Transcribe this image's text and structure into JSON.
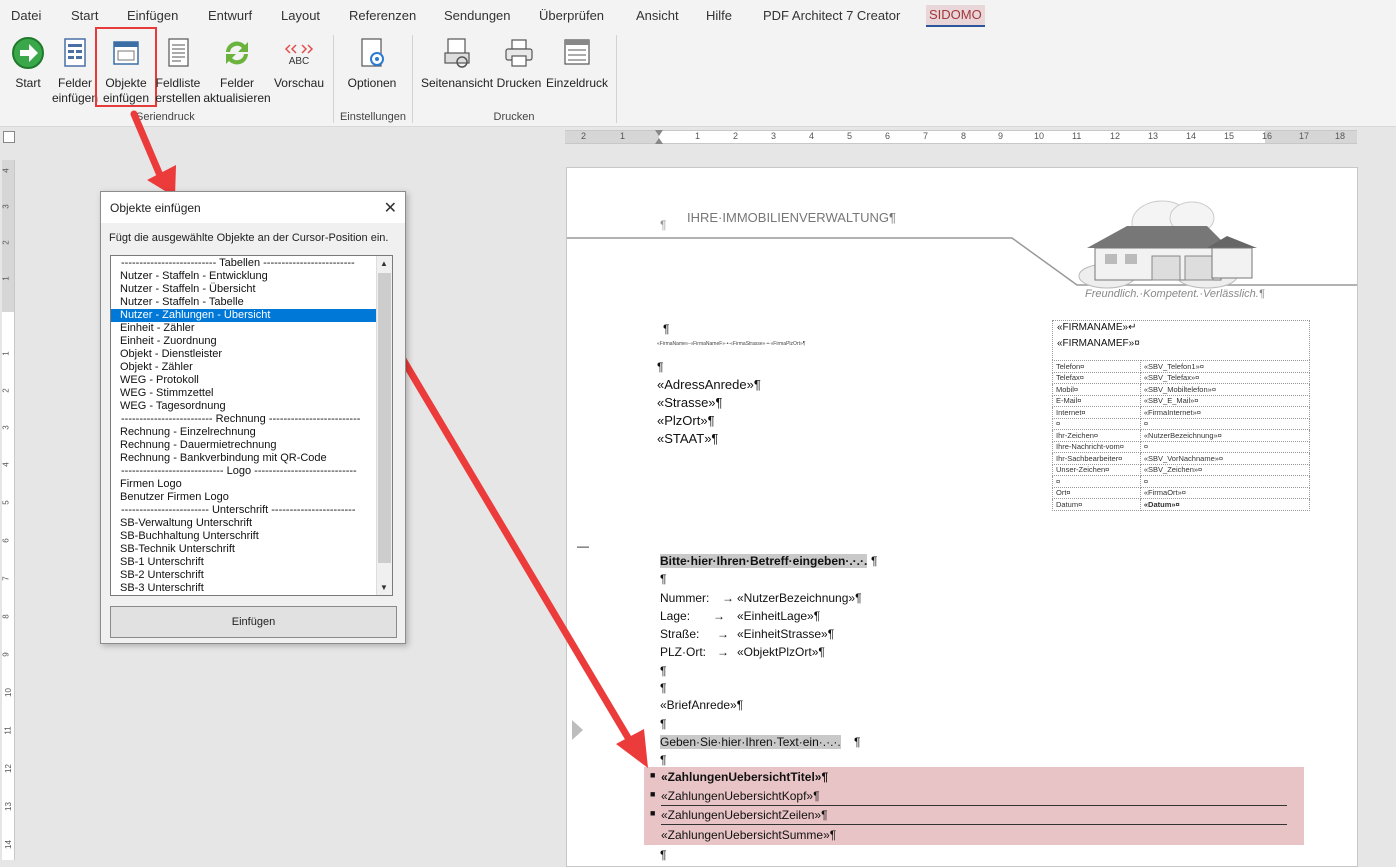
{
  "tabs": [
    "Datei",
    "Start",
    "Einfügen",
    "Entwurf",
    "Layout",
    "Referenzen",
    "Sendungen",
    "Überprüfen",
    "Ansicht",
    "Hilfe",
    "PDF Architect 7 Creator",
    "SIDOMO"
  ],
  "ribbon": {
    "buttons": [
      {
        "label1": "Start",
        "label2": "",
        "icon": "start-arrow-icon"
      },
      {
        "label1": "Felder",
        "label2": "einfügen",
        "icon": "insert-fields-icon"
      },
      {
        "label1": "Objekte",
        "label2": "einfügen",
        "icon": "insert-objects-icon"
      },
      {
        "label1": "Feldliste",
        "label2": "erstellen",
        "icon": "field-list-icon"
      },
      {
        "label1": "Felder",
        "label2": "aktualisieren",
        "icon": "refresh-icon"
      },
      {
        "label1": "Vorschau",
        "label2": "",
        "icon": "preview-abc-icon"
      },
      {
        "label1": "Optionen",
        "label2": "",
        "icon": "options-icon"
      },
      {
        "label1": "Seitenansicht",
        "label2": "",
        "icon": "page-view-icon"
      },
      {
        "label1": "Drucken",
        "label2": "",
        "icon": "printer-icon"
      },
      {
        "label1": "Einzeldruck",
        "label2": "",
        "icon": "single-print-icon"
      }
    ],
    "groups": [
      "Seriendruck",
      "Einstellungen",
      "Drucken"
    ],
    "preview_glyph": "ABC"
  },
  "ruler": {
    "h_ticks": [
      "2",
      "1",
      "1",
      "2",
      "3",
      "4",
      "5",
      "6",
      "7",
      "8",
      "9",
      "10",
      "11",
      "12",
      "13",
      "14",
      "15",
      "16",
      "17",
      "18"
    ],
    "v_ticks": [
      "4",
      "3",
      "2",
      "1",
      "1",
      "2",
      "3",
      "4",
      "5",
      "6",
      "7",
      "8",
      "9",
      "10",
      "11",
      "12",
      "13",
      "14"
    ]
  },
  "dialog": {
    "title": "Objekte einfügen",
    "description": "Fügt die ausgewählte Objekte an der Cursor-Position ein.",
    "button": "Einfügen",
    "items": [
      "-------------------------- Tabellen -------------------------",
      "Nutzer - Staffeln - Entwicklung",
      "Nutzer - Staffeln - Übersicht",
      "Nutzer - Staffeln - Tabelle",
      "Nutzer - Zahlungen - Übersicht",
      "Einheit - Zähler",
      "Einheit - Zuordnung",
      "Objekt - Dienstleister",
      "Objekt - Zähler",
      "WEG - Protokoll",
      "WEG - Stimmzettel",
      "WEG - Tagesordnung",
      "------------------------- Rechnung -------------------------",
      "Rechnung - Einzelrechnung",
      "Rechnung - Dauermietrechnung",
      "Rechnung - Bankverbindung mit QR-Code",
      "---------------------------- Logo ----------------------------",
      "Firmen Logo",
      "Benutzer Firmen Logo",
      "------------------------ Unterschrift -----------------------",
      "SB-Verwaltung Unterschrift",
      "SB-Buchhaltung Unterschrift",
      "SB-Technik Unterschrift",
      "SB-1 Unterschrift",
      "SB-2 Unterschrift",
      "SB-3 Unterschrift"
    ],
    "selected_index": 4
  },
  "document": {
    "header_pilcrow": "¶",
    "header_title": "IHRE·IMMOBILIENVERWALTUNG¶",
    "slogan": "Freundlich.·Kompetent.·Verlässlich.¶",
    "pilcrow": "¶",
    "sender_line": "«FirmaName»·«FirmaNameF»·•·«FirmaStrasse»·•·«FirmaPlzOrt»¶",
    "address": [
      "«AdressAnrede»¶",
      "«Strasse»¶",
      "«PlzOrt»¶",
      "«STAAT»¶"
    ],
    "firm1": "«FIRMANAME»↵",
    "firm2": "«FIRMANAMEF»¤",
    "info_rows": [
      [
        "Telefon¤",
        "«SBV_Telefon1»¤"
      ],
      [
        "Telefax¤",
        "«SBV_Telefax»¤"
      ],
      [
        "Mobil¤",
        "«SBV_Mobiltelefon»¤"
      ],
      [
        "E-Mail¤",
        "«SBV_E_Mail»¤"
      ],
      [
        "Internet¤",
        "«FirmaInternet»¤"
      ],
      [
        "¤",
        "¤"
      ],
      [
        "Ihr-Zeichen¤",
        "«NutzerBezeichnung»¤"
      ],
      [
        "Ihre-Nachricht-vom¤",
        "¤"
      ],
      [
        "Ihr-Sachbearbeiter¤",
        "«SBV_VorNachname»¤"
      ],
      [
        "Unser-Zeichen¤",
        "«SBV_Zeichen»¤"
      ],
      [
        "¤",
        "¤"
      ],
      [
        "Ort¤",
        "«FirmaOrt»¤"
      ],
      [
        "Datum¤",
        "«Datum»¤"
      ]
    ],
    "subject": "Bitte·hier·Ihren·Betreff·eingeben·.·.·.",
    "fields": [
      {
        "label": "Nummer:",
        "arrow": "→",
        "value": "«NutzerBezeichnung»¶"
      },
      {
        "label": "Lage:",
        "arrow": "→",
        "value": "«EinheitLage»¶"
      },
      {
        "label": "Straße:",
        "arrow": "→",
        "value": "«EinheitStrasse»¶"
      },
      {
        "label": "PLZ·Ort:",
        "arrow": "→",
        "value": "«ObjektPlzOrt»¶"
      }
    ],
    "salutation": "«BriefAnrede»¶",
    "body_text": "Geben·Sie·hier·Ihren·Text·ein·.·.·.",
    "mergefields": [
      "«ZahlungenUebersichtTitel»¶",
      "«ZahlungenUebersichtKopf»¶",
      "«ZahlungenUebersichtZeilen»¶",
      "«ZahlungenUebersichtSumme»¶"
    ]
  },
  "colors": {
    "accent_red": "#e53b3b",
    "selection": "#0078d7",
    "highlight": "#e8c4c6"
  }
}
